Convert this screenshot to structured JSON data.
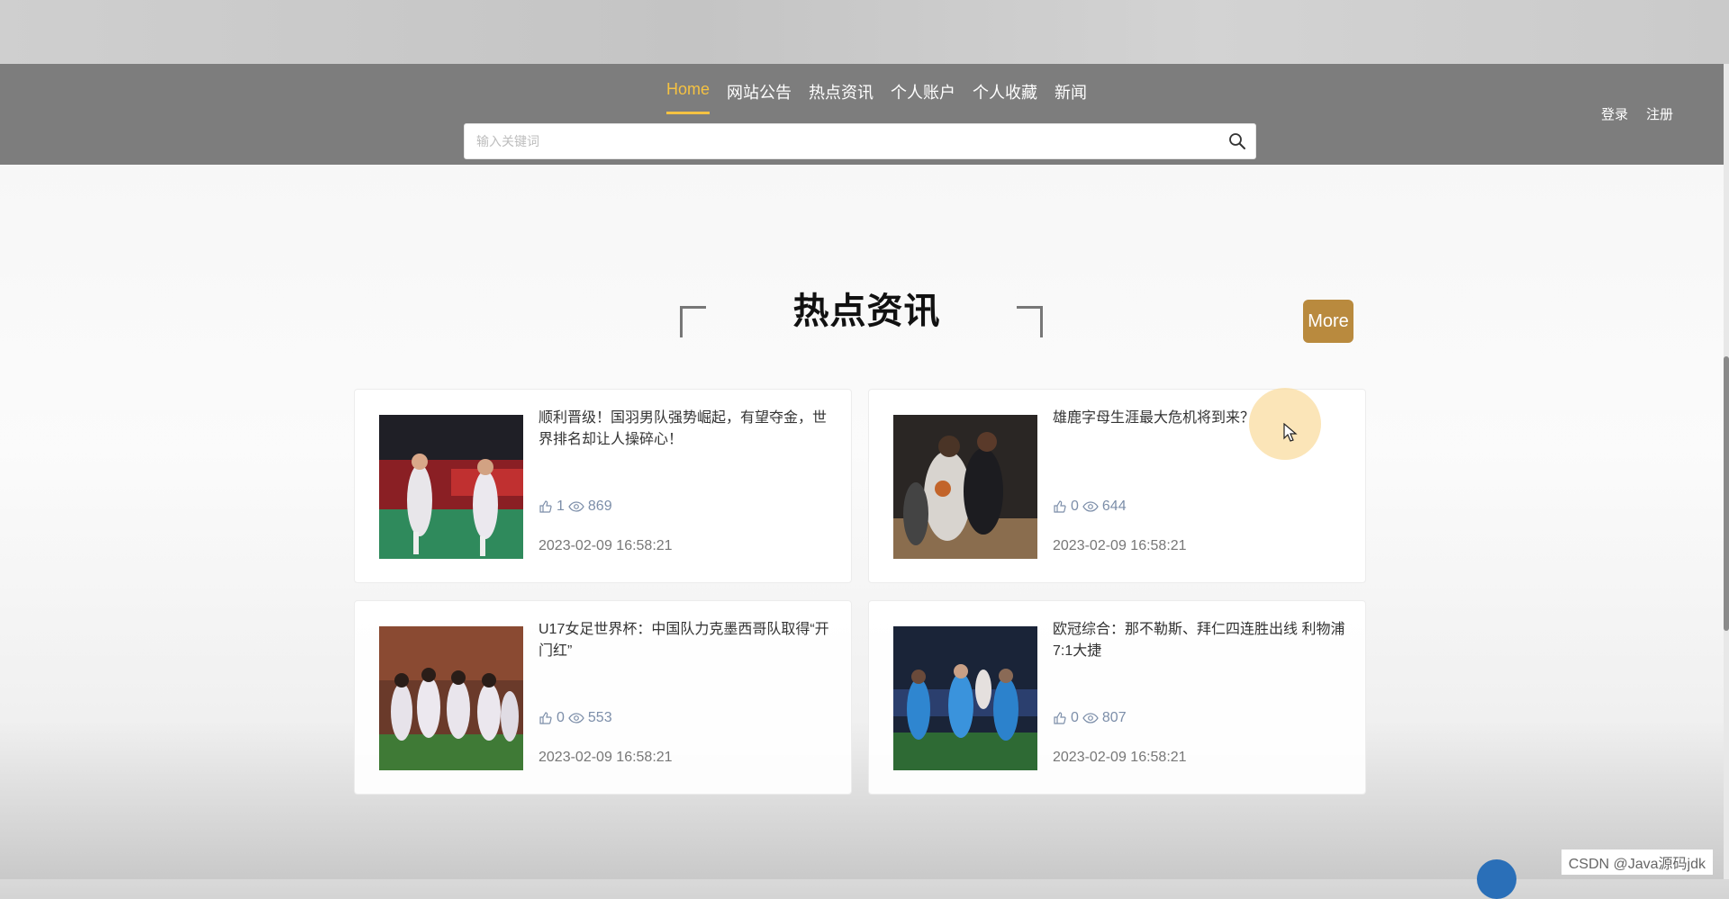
{
  "nav": {
    "items": [
      {
        "label": "Home",
        "active": true
      },
      {
        "label": "网站公告",
        "active": false
      },
      {
        "label": "热点资讯",
        "active": false
      },
      {
        "label": "个人账户",
        "active": false
      },
      {
        "label": "个人收藏",
        "active": false
      },
      {
        "label": "新闻",
        "active": false
      }
    ],
    "active_color": "#f5c242"
  },
  "search": {
    "placeholder": "输入关键词",
    "value": ""
  },
  "auth": {
    "login": "登录",
    "register": "注册"
  },
  "section": {
    "title": "热点资讯",
    "more_label": "More",
    "more_color": "#b98a3e"
  },
  "articles": [
    {
      "title": "顺利晋级！国羽男队强势崛起，有望夺金，世界排名却让人操碎心！",
      "likes": "1",
      "views": "869",
      "date": "2023-02-09 16:58:21",
      "image": "badminton-photo"
    },
    {
      "title": "雄鹿字母生涯最大危机将到来？",
      "likes": "0",
      "views": "644",
      "date": "2023-02-09 16:58:21",
      "image": "basketball-photo"
    },
    {
      "title": "U17女足世界杯：中国队力克墨西哥队取得“开门红”",
      "likes": "0",
      "views": "553",
      "date": "2023-02-09 16:58:21",
      "image": "womens-football-photo"
    },
    {
      "title": "欧冠综合：那不勒斯、拜仁四连胜出线 利物浦7:1大捷",
      "likes": "0",
      "views": "807",
      "date": "2023-02-09 16:58:21",
      "image": "champions-league-photo"
    }
  ],
  "watermark": "CSDN @Java源码jdk"
}
